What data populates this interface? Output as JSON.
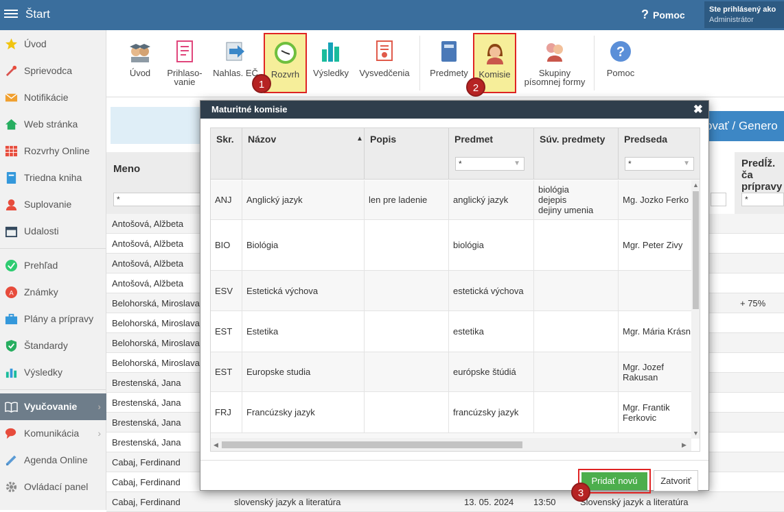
{
  "app": {
    "title": "Štart"
  },
  "header": {
    "help_label": "Pomoc",
    "user_line1": "Ste prihlásený ako",
    "user_line2": "Administrátor"
  },
  "sidebar": {
    "items": [
      {
        "label": "Úvod",
        "icon": "star-icon"
      },
      {
        "label": "Sprievodca",
        "icon": "magic-wand-icon"
      },
      {
        "label": "Notifikácie",
        "icon": "envelope-icon"
      },
      {
        "label": "Web stránka",
        "icon": "house-icon"
      },
      {
        "label": "Rozvrhy Online",
        "icon": "timetable-icon"
      },
      {
        "label": "Triedna kniha",
        "icon": "book-icon"
      },
      {
        "label": "Suplovanie",
        "icon": "person-icon"
      },
      {
        "label": "Udalosti",
        "icon": "calendar-icon"
      },
      {
        "label": "Prehľad",
        "icon": "check-circle-icon"
      },
      {
        "label": "Známky",
        "icon": "grade-icon"
      },
      {
        "label": "Plány a prípravy",
        "icon": "briefcase-icon"
      },
      {
        "label": "Štandardy",
        "icon": "shield-check-icon"
      },
      {
        "label": "Výsledky",
        "icon": "bar-chart-icon"
      },
      {
        "label": "Vyučovanie",
        "icon": "open-book-icon"
      },
      {
        "label": "Komunikácia",
        "icon": "chat-icon"
      },
      {
        "label": "Agenda Online",
        "icon": "pen-icon"
      },
      {
        "label": "Ovládací panel",
        "icon": "gear-icon"
      }
    ]
  },
  "toolbar": {
    "items": [
      {
        "label": "Úvod",
        "icon": "graduates-icon"
      },
      {
        "label": "Prihlaso-\nvanie",
        "icon": "form-icon"
      },
      {
        "label": "Nahlas. EČ",
        "icon": "arrow-right-icon"
      },
      {
        "label": "Rozvrh",
        "icon": "clock-icon"
      },
      {
        "label": "Výsledky",
        "icon": "bar-chart-icon"
      },
      {
        "label": "Vysvedčenia",
        "icon": "certificate-icon"
      },
      {
        "label": "Predmety",
        "icon": "book-icon"
      },
      {
        "label": "Komisie",
        "icon": "woman-icon"
      },
      {
        "label": "Skupiny\npísomnej formy",
        "icon": "group-icon"
      },
      {
        "label": "Pomoc",
        "icon": "question-icon"
      }
    ]
  },
  "steps": [
    "1",
    "2",
    "3"
  ],
  "background": {
    "button_partial": "ovať / Genero",
    "col_meno": "Meno",
    "col_predlz": "Predĺž. ča\nprípravy",
    "filter_value": "*",
    "rows": [
      {
        "name": "Antošová, Alžbeta",
        "extra": ""
      },
      {
        "name": "Antošová, Alžbeta",
        "extra": ""
      },
      {
        "name": "Antošová, Alžbeta",
        "extra": ""
      },
      {
        "name": "Antošová, Alžbeta",
        "extra": ""
      },
      {
        "name": "Belohorská, Miroslava",
        "extra": "+ 75%"
      },
      {
        "name": "Belohorská, Miroslava",
        "extra": ""
      },
      {
        "name": "Belohorská, Miroslava",
        "extra": ""
      },
      {
        "name": "Belohorská, Miroslava",
        "extra": ""
      },
      {
        "name": "Brestenská, Jana",
        "extra": ""
      },
      {
        "name": "Brestenská, Jana",
        "extra": ""
      },
      {
        "name": "Brestenská, Jana",
        "extra": ""
      },
      {
        "name": "Brestenská, Jana",
        "extra": ""
      },
      {
        "name": "Cabaj, Ferdinand",
        "extra": ""
      },
      {
        "name": "Cabaj, Ferdinand",
        "extra": ""
      },
      {
        "name": "Cabaj, Ferdinand",
        "extra": ""
      }
    ],
    "last_row": {
      "subject": "slovenský jazyk a literatúra",
      "date": "13. 05. 2024",
      "time": "13:50",
      "subject2": "Slovenský jazyk a literatúra"
    }
  },
  "modal": {
    "title": "Maturitné komisie",
    "columns": [
      "Skr.",
      "Názov",
      "Popis",
      "Predmet",
      "Súv. predmety",
      "Predseda"
    ],
    "filter_value": "*",
    "rows": [
      {
        "skr": "ANJ",
        "nazov": "Anglický jazyk",
        "popis": "len pre ladenie",
        "predmet": "anglický jazyk",
        "suv": "biológia\ndejepis\ndejiny umenia",
        "predseda": "Mg. Jozko Ferko"
      },
      {
        "skr": "BIO",
        "nazov": "Biológia",
        "popis": "",
        "predmet": "biológia",
        "suv": "",
        "predseda": "Mgr. Peter Zivy"
      },
      {
        "skr": "ESV",
        "nazov": "Estetická výchova",
        "popis": "",
        "predmet": "estetická výchova",
        "suv": "",
        "predseda": ""
      },
      {
        "skr": "EST",
        "nazov": "Estetika",
        "popis": "",
        "predmet": "estetika",
        "suv": "",
        "predseda": "Mgr. Mária Krásn"
      },
      {
        "skr": "EST",
        "nazov": "Europske studia",
        "popis": "",
        "predmet": "európske štúdiá",
        "suv": "",
        "predseda": "Mgr. Jozef\nRakusan"
      },
      {
        "skr": "FRJ",
        "nazov": "Francúzsky jazyk",
        "popis": "",
        "predmet": "francúzsky jazyk",
        "suv": "",
        "predseda": "Mgr. Frantik\nFerkovic"
      }
    ],
    "add_button": "Pridať novú",
    "close_button": "Zatvoriť"
  }
}
